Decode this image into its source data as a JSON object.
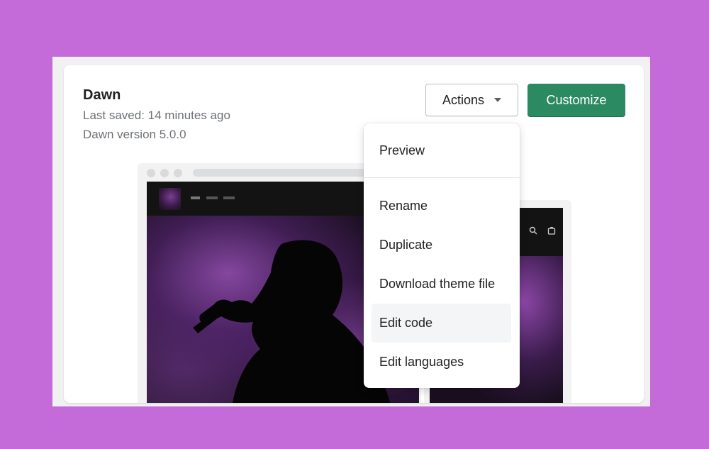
{
  "theme": {
    "name": "Dawn",
    "last_saved": "Last saved: 14 minutes ago",
    "version": "Dawn version 5.0.0"
  },
  "buttons": {
    "actions_label": "Actions",
    "customize_label": "Customize"
  },
  "actions_menu": {
    "items": [
      {
        "label": "Preview"
      },
      {
        "label": "Rename"
      },
      {
        "label": "Duplicate"
      },
      {
        "label": "Download theme file"
      },
      {
        "label": "Edit code",
        "hovered": true
      },
      {
        "label": "Edit languages"
      }
    ]
  },
  "preview": {
    "mobile_icons": [
      "search-icon",
      "cart-icon"
    ]
  },
  "colors": {
    "background": "#c46ad9",
    "primary_button": "#2b8a62",
    "text": "#202223",
    "subdued_text": "#6d7175"
  }
}
